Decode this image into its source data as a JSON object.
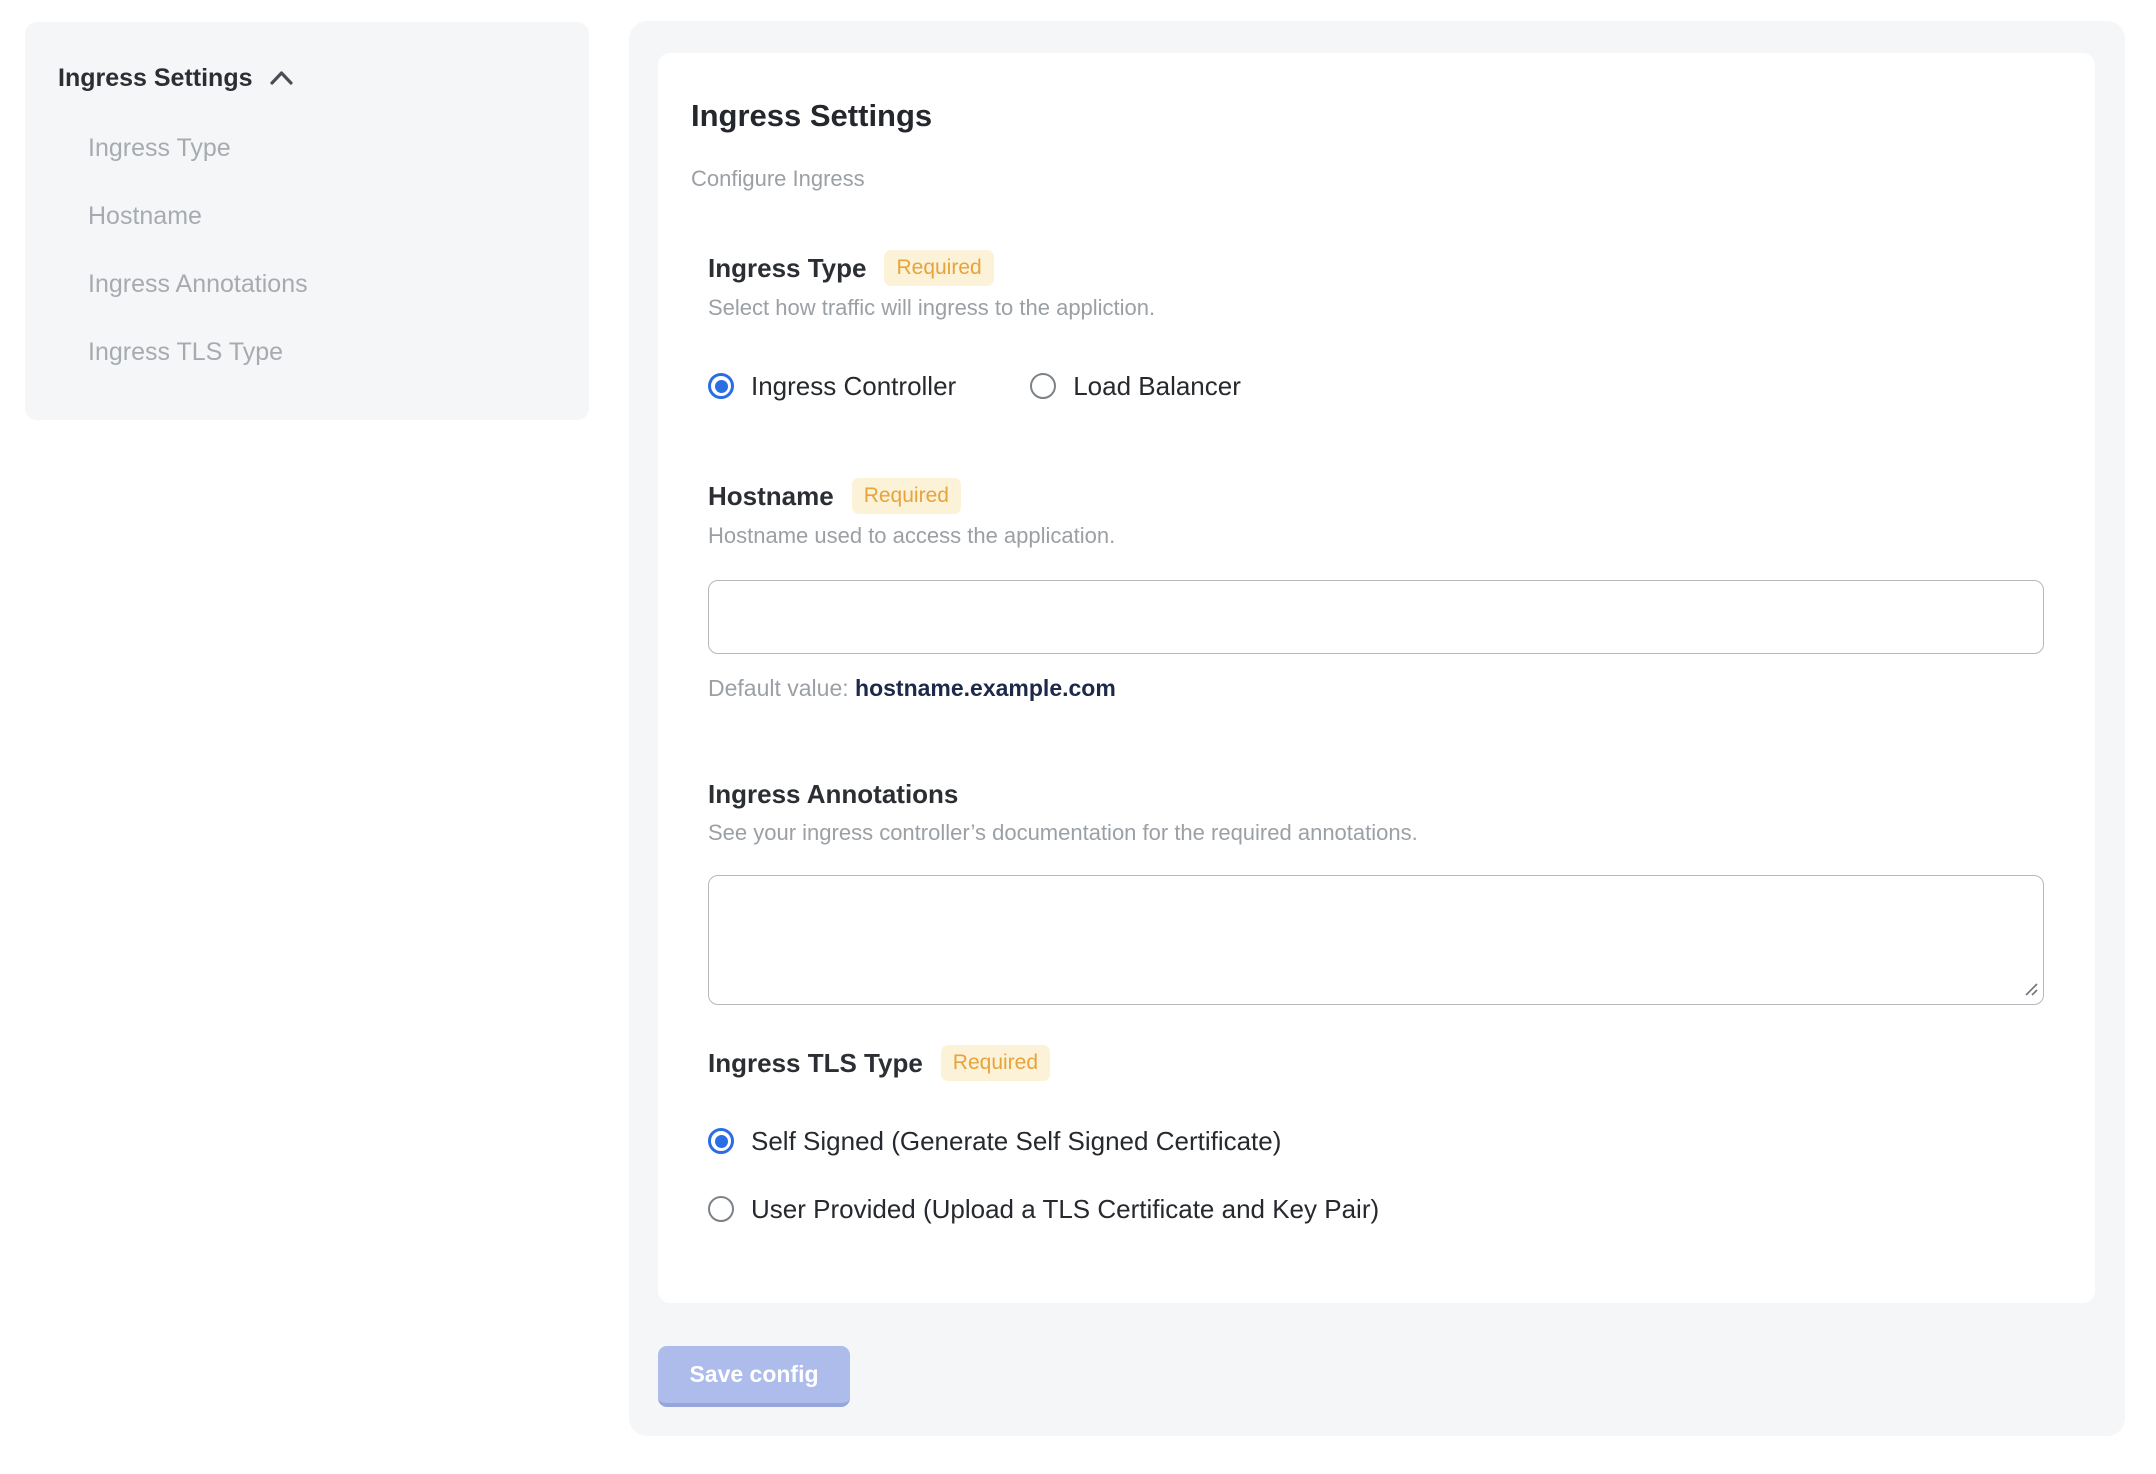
{
  "sidebar": {
    "title": "Ingress Settings",
    "items": [
      {
        "label": "Ingress Type"
      },
      {
        "label": "Hostname"
      },
      {
        "label": "Ingress Annotations"
      },
      {
        "label": "Ingress TLS Type"
      }
    ]
  },
  "main": {
    "title": "Ingress Settings",
    "subtitle": "Configure Ingress",
    "required_badge": "Required",
    "sections": {
      "ingress_type": {
        "label": "Ingress Type",
        "description": "Select how traffic will ingress to the appliction.",
        "options": [
          {
            "label": "Ingress Controller",
            "selected": true
          },
          {
            "label": "Load Balancer",
            "selected": false
          }
        ]
      },
      "hostname": {
        "label": "Hostname",
        "description": "Hostname used to access the application.",
        "input_value": "",
        "default_value_label": "Default value: ",
        "default_value": "hostname.example.com"
      },
      "annotations": {
        "label": "Ingress Annotations",
        "description": "See your ingress controller’s documentation for the required annotations.",
        "textarea_value": ""
      },
      "tls_type": {
        "label": "Ingress TLS Type",
        "options": [
          {
            "label": "Self Signed (Generate Self Signed Certificate)",
            "selected": true
          },
          {
            "label": "User Provided (Upload a TLS Certificate and Key Pair)",
            "selected": false
          }
        ]
      }
    },
    "save_button": "Save config"
  },
  "colors": {
    "accent_blue": "#2b6de4",
    "badge_bg": "#fcf2d7",
    "badge_text": "#e7a33c",
    "save_button_bg": "#adbceb",
    "default_value_text": "#1d2949",
    "panel_bg": "#f5f6f8"
  }
}
